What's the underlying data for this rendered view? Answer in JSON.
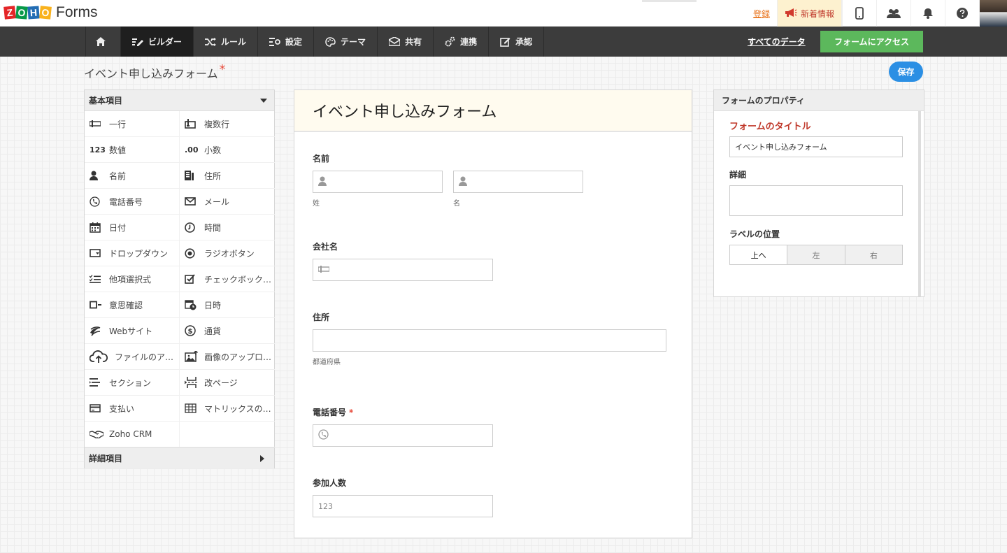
{
  "brand": {
    "letters": [
      "Z",
      "O",
      "H",
      "O"
    ],
    "product": "Forms"
  },
  "topbar": {
    "register": "登録",
    "news": "新着情報"
  },
  "nav": {
    "items": [
      {
        "label": "ビルダー"
      },
      {
        "label": "ルール"
      },
      {
        "label": "設定"
      },
      {
        "label": "テーマ"
      },
      {
        "label": "共有"
      },
      {
        "label": "連携"
      },
      {
        "label": "承認"
      }
    ],
    "all_data": "すべてのデータ",
    "access": "フォームにアクセス"
  },
  "form_title_bar": {
    "name": "イベント申し込みフォーム",
    "required_mark": "*",
    "save": "保存"
  },
  "palette": {
    "header": "基本項目",
    "footer": "詳細項目",
    "items": [
      {
        "label": "一行",
        "icon": "single-line-icon"
      },
      {
        "label": "複数行",
        "icon": "multi-line-icon"
      },
      {
        "label": "数値",
        "icon": "number-icon",
        "glyph": "123"
      },
      {
        "label": "小数",
        "icon": "decimal-icon",
        "glyph": ".00"
      },
      {
        "label": "名前",
        "icon": "person-icon"
      },
      {
        "label": "住所",
        "icon": "address-icon"
      },
      {
        "label": "電話番号",
        "icon": "phone-icon"
      },
      {
        "label": "メール",
        "icon": "mail-icon"
      },
      {
        "label": "日付",
        "icon": "calendar-icon"
      },
      {
        "label": "時間",
        "icon": "clock-icon"
      },
      {
        "label": "ドロップダウン",
        "icon": "dropdown-icon"
      },
      {
        "label": "ラジオボタン",
        "icon": "radio-icon"
      },
      {
        "label": "他項選択式",
        "icon": "multi-choice-icon"
      },
      {
        "label": "チェックボック…",
        "icon": "checkbox-icon"
      },
      {
        "label": "意思確認",
        "icon": "decision-icon"
      },
      {
        "label": "日時",
        "icon": "datetime-icon"
      },
      {
        "label": "Webサイト",
        "icon": "globe-icon"
      },
      {
        "label": "通貨",
        "icon": "currency-icon"
      },
      {
        "label": "ファイルのア…",
        "icon": "upload-cloud-icon"
      },
      {
        "label": "画像のアップロ…",
        "icon": "image-upload-icon"
      },
      {
        "label": "セクション",
        "icon": "section-icon"
      },
      {
        "label": "改ページ",
        "icon": "page-break-icon"
      },
      {
        "label": "支払い",
        "icon": "credit-card-icon"
      },
      {
        "label": "マトリックスの…",
        "icon": "matrix-icon"
      },
      {
        "label": "Zoho CRM",
        "icon": "handshake-icon"
      },
      {
        "label": "",
        "icon": ""
      }
    ]
  },
  "canvas": {
    "title": "イベント申し込みフォーム",
    "name_field": {
      "label": "名前",
      "first_sub": "姓",
      "last_sub": "名"
    },
    "company_field": {
      "label": "会社名"
    },
    "address_field": {
      "label": "住所",
      "sub": "都道府県"
    },
    "phone_field": {
      "label": "電話番号",
      "required": "*"
    },
    "count_field": {
      "label": "参加人数",
      "placeholder": "123"
    }
  },
  "properties": {
    "header": "フォームのプロパティ",
    "title_label": "フォームのタイトル",
    "title_value": "イベント申し込みフォーム",
    "detail_label": "詳細",
    "detail_value": "",
    "label_pos_label": "ラベルの位置",
    "label_pos_options": [
      "上へ",
      "左",
      "右"
    ],
    "label_pos_selected": "上へ"
  },
  "colors": {
    "accent_green": "#5cb85c",
    "save_blue": "#2b8fe4",
    "nav_dark": "#3c3c3c",
    "required_red": "#e74c3c"
  }
}
